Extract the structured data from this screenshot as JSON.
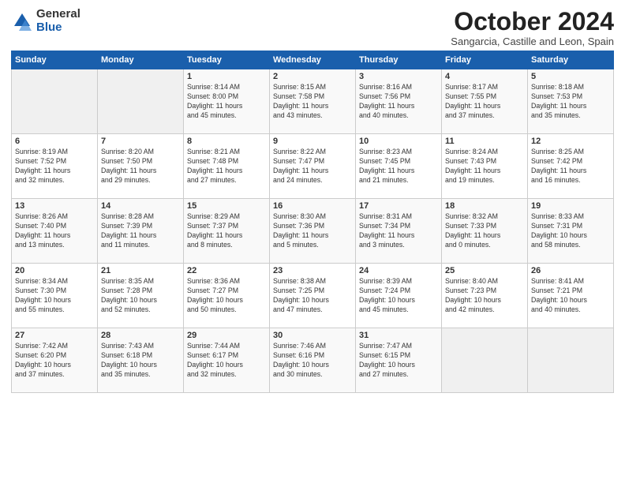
{
  "logo": {
    "general": "General",
    "blue": "Blue"
  },
  "title": "October 2024",
  "subtitle": "Sangarcia, Castille and Leon, Spain",
  "weekdays": [
    "Sunday",
    "Monday",
    "Tuesday",
    "Wednesday",
    "Thursday",
    "Friday",
    "Saturday"
  ],
  "weeks": [
    [
      {
        "day": "",
        "info": ""
      },
      {
        "day": "",
        "info": ""
      },
      {
        "day": "1",
        "info": "Sunrise: 8:14 AM\nSunset: 8:00 PM\nDaylight: 11 hours\nand 45 minutes."
      },
      {
        "day": "2",
        "info": "Sunrise: 8:15 AM\nSunset: 7:58 PM\nDaylight: 11 hours\nand 43 minutes."
      },
      {
        "day": "3",
        "info": "Sunrise: 8:16 AM\nSunset: 7:56 PM\nDaylight: 11 hours\nand 40 minutes."
      },
      {
        "day": "4",
        "info": "Sunrise: 8:17 AM\nSunset: 7:55 PM\nDaylight: 11 hours\nand 37 minutes."
      },
      {
        "day": "5",
        "info": "Sunrise: 8:18 AM\nSunset: 7:53 PM\nDaylight: 11 hours\nand 35 minutes."
      }
    ],
    [
      {
        "day": "6",
        "info": "Sunrise: 8:19 AM\nSunset: 7:52 PM\nDaylight: 11 hours\nand 32 minutes."
      },
      {
        "day": "7",
        "info": "Sunrise: 8:20 AM\nSunset: 7:50 PM\nDaylight: 11 hours\nand 29 minutes."
      },
      {
        "day": "8",
        "info": "Sunrise: 8:21 AM\nSunset: 7:48 PM\nDaylight: 11 hours\nand 27 minutes."
      },
      {
        "day": "9",
        "info": "Sunrise: 8:22 AM\nSunset: 7:47 PM\nDaylight: 11 hours\nand 24 minutes."
      },
      {
        "day": "10",
        "info": "Sunrise: 8:23 AM\nSunset: 7:45 PM\nDaylight: 11 hours\nand 21 minutes."
      },
      {
        "day": "11",
        "info": "Sunrise: 8:24 AM\nSunset: 7:43 PM\nDaylight: 11 hours\nand 19 minutes."
      },
      {
        "day": "12",
        "info": "Sunrise: 8:25 AM\nSunset: 7:42 PM\nDaylight: 11 hours\nand 16 minutes."
      }
    ],
    [
      {
        "day": "13",
        "info": "Sunrise: 8:26 AM\nSunset: 7:40 PM\nDaylight: 11 hours\nand 13 minutes."
      },
      {
        "day": "14",
        "info": "Sunrise: 8:28 AM\nSunset: 7:39 PM\nDaylight: 11 hours\nand 11 minutes."
      },
      {
        "day": "15",
        "info": "Sunrise: 8:29 AM\nSunset: 7:37 PM\nDaylight: 11 hours\nand 8 minutes."
      },
      {
        "day": "16",
        "info": "Sunrise: 8:30 AM\nSunset: 7:36 PM\nDaylight: 11 hours\nand 5 minutes."
      },
      {
        "day": "17",
        "info": "Sunrise: 8:31 AM\nSunset: 7:34 PM\nDaylight: 11 hours\nand 3 minutes."
      },
      {
        "day": "18",
        "info": "Sunrise: 8:32 AM\nSunset: 7:33 PM\nDaylight: 11 hours\nand 0 minutes."
      },
      {
        "day": "19",
        "info": "Sunrise: 8:33 AM\nSunset: 7:31 PM\nDaylight: 10 hours\nand 58 minutes."
      }
    ],
    [
      {
        "day": "20",
        "info": "Sunrise: 8:34 AM\nSunset: 7:30 PM\nDaylight: 10 hours\nand 55 minutes."
      },
      {
        "day": "21",
        "info": "Sunrise: 8:35 AM\nSunset: 7:28 PM\nDaylight: 10 hours\nand 52 minutes."
      },
      {
        "day": "22",
        "info": "Sunrise: 8:36 AM\nSunset: 7:27 PM\nDaylight: 10 hours\nand 50 minutes."
      },
      {
        "day": "23",
        "info": "Sunrise: 8:38 AM\nSunset: 7:25 PM\nDaylight: 10 hours\nand 47 minutes."
      },
      {
        "day": "24",
        "info": "Sunrise: 8:39 AM\nSunset: 7:24 PM\nDaylight: 10 hours\nand 45 minutes."
      },
      {
        "day": "25",
        "info": "Sunrise: 8:40 AM\nSunset: 7:23 PM\nDaylight: 10 hours\nand 42 minutes."
      },
      {
        "day": "26",
        "info": "Sunrise: 8:41 AM\nSunset: 7:21 PM\nDaylight: 10 hours\nand 40 minutes."
      }
    ],
    [
      {
        "day": "27",
        "info": "Sunrise: 7:42 AM\nSunset: 6:20 PM\nDaylight: 10 hours\nand 37 minutes."
      },
      {
        "day": "28",
        "info": "Sunrise: 7:43 AM\nSunset: 6:18 PM\nDaylight: 10 hours\nand 35 minutes."
      },
      {
        "day": "29",
        "info": "Sunrise: 7:44 AM\nSunset: 6:17 PM\nDaylight: 10 hours\nand 32 minutes."
      },
      {
        "day": "30",
        "info": "Sunrise: 7:46 AM\nSunset: 6:16 PM\nDaylight: 10 hours\nand 30 minutes."
      },
      {
        "day": "31",
        "info": "Sunrise: 7:47 AM\nSunset: 6:15 PM\nDaylight: 10 hours\nand 27 minutes."
      },
      {
        "day": "",
        "info": ""
      },
      {
        "day": "",
        "info": ""
      }
    ]
  ]
}
